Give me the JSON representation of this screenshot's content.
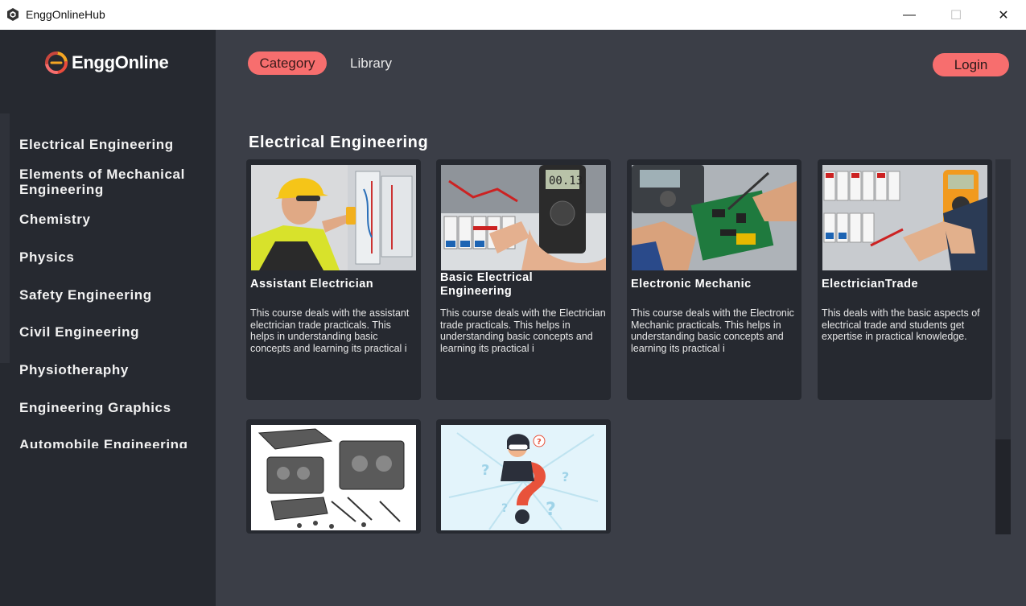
{
  "window": {
    "title": "EnggOnlineHub",
    "controls": {
      "minimize": "—",
      "maximize": "☐",
      "close": "✕"
    }
  },
  "brand": {
    "logo_text": "EnggOnline",
    "accent_colors": [
      "#f76e6e",
      "#f5a623",
      "#e94b3c"
    ]
  },
  "nav": {
    "category": "Category",
    "library": "Library",
    "login": "Login",
    "active_color": "#f76e6e"
  },
  "sidebar": {
    "items": [
      {
        "label": "Electrical Engineering"
      },
      {
        "label": "Elements of Mechanical Engineering"
      },
      {
        "label": "Chemistry"
      },
      {
        "label": "Physics"
      },
      {
        "label": "Safety Engineering"
      },
      {
        "label": "Civil Engineering"
      },
      {
        "label": "Physiotheraphy"
      },
      {
        "label": "Engineering Graphics"
      },
      {
        "label": "Automobile Engineering"
      }
    ]
  },
  "main": {
    "section_title": "Electrical Engineering",
    "courses": [
      {
        "title": "Assistant Electrician",
        "description": "This course deals with the assistant electrician trade practicals. This helps in understanding basic concepts and learning its practical i",
        "image_icon": "electrician-photo-icon"
      },
      {
        "title": "Basic Electrical Engineering",
        "description": "This course deals with the Electrician trade practicals. This helps in understanding basic concepts and learning its practical i",
        "image_icon": "multimeter-photo-icon"
      },
      {
        "title": "Electronic Mechanic",
        "description": "This course deals with the Electronic Mechanic practicals. This helps in understanding basic concepts and learning its practical i",
        "image_icon": "circuit-board-photo-icon"
      },
      {
        "title": "ElectricianTrade",
        "description": "This deals with the basic aspects of electrical trade and students get expertise in practical knowledge.",
        "image_icon": "panel-testing-photo-icon"
      },
      {
        "title": "",
        "description": "",
        "image_icon": "engine-parts-photo-icon"
      },
      {
        "title": "",
        "description": "",
        "image_icon": "question-mark-illustration-icon"
      }
    ]
  }
}
